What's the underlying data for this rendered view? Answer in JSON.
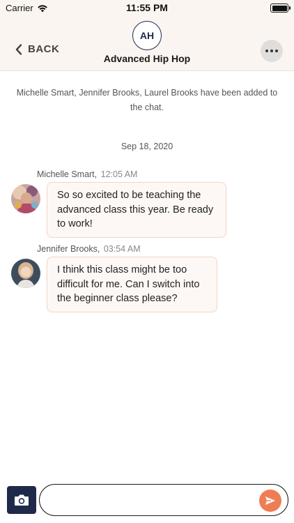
{
  "status_bar": {
    "carrier": "Carrier",
    "time": "11:55 PM"
  },
  "header": {
    "back_label": "BACK",
    "avatar_initials": "AH",
    "title": "Advanced Hip Hop"
  },
  "system_message": "Michelle Smart, Jennifer Brooks, Laurel Brooks have been added to the chat.",
  "date_divider": "Sep 18, 2020",
  "messages": [
    {
      "sender": "Michelle Smart,",
      "time": "12:05 AM",
      "text": "So so excited to be teaching the advanced class this year. Be ready to work!"
    },
    {
      "sender": "Jennifer Brooks,",
      "time": "03:54 AM",
      "text": "I think this class might be too difficult for me. Can I switch into the beginner class please?"
    }
  ],
  "composer": {
    "placeholder": ""
  },
  "colors": {
    "header_bg": "#faf5f1",
    "navy": "#1f2a4a",
    "send_orange": "#ee7d55",
    "bubble_border": "#f1d5c7"
  }
}
